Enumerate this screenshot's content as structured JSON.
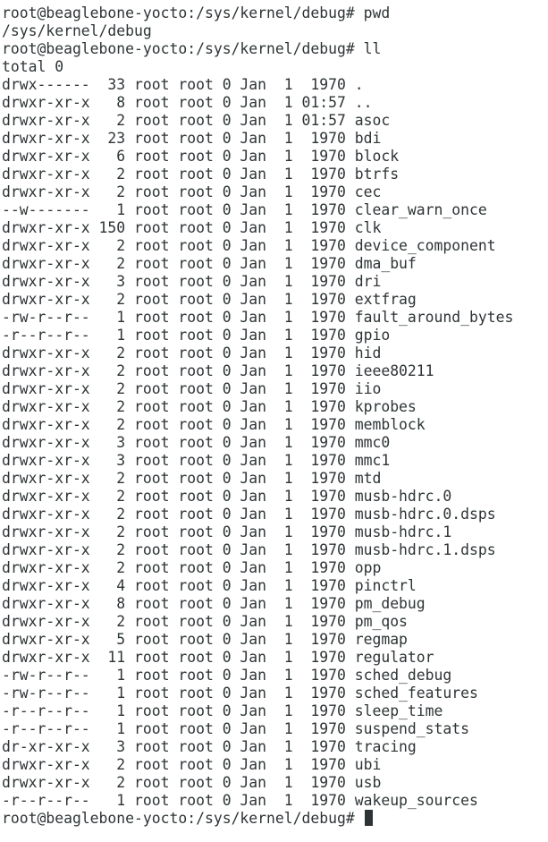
{
  "terminal": {
    "prompt": "root@beaglebone-yocto:/sys/kernel/debug#",
    "lines": [
      "root@beaglebone-yocto:/sys/kernel/debug# pwd",
      "/sys/kernel/debug",
      "root@beaglebone-yocto:/sys/kernel/debug# ll",
      "total 0",
      "drwx------  33 root root 0 Jan  1  1970 .",
      "drwxr-xr-x   8 root root 0 Jan  1 01:57 ..",
      "drwxr-xr-x   2 root root 0 Jan  1 01:57 asoc",
      "drwxr-xr-x  23 root root 0 Jan  1  1970 bdi",
      "drwxr-xr-x   6 root root 0 Jan  1  1970 block",
      "drwxr-xr-x   2 root root 0 Jan  1  1970 btrfs",
      "drwxr-xr-x   2 root root 0 Jan  1  1970 cec",
      "--w-------   1 root root 0 Jan  1  1970 clear_warn_once",
      "drwxr-xr-x 150 root root 0 Jan  1  1970 clk",
      "drwxr-xr-x   2 root root 0 Jan  1  1970 device_component",
      "drwxr-xr-x   2 root root 0 Jan  1  1970 dma_buf",
      "drwxr-xr-x   3 root root 0 Jan  1  1970 dri",
      "drwxr-xr-x   2 root root 0 Jan  1  1970 extfrag",
      "-rw-r--r--   1 root root 0 Jan  1  1970 fault_around_bytes",
      "-r--r--r--   1 root root 0 Jan  1  1970 gpio",
      "drwxr-xr-x   2 root root 0 Jan  1  1970 hid",
      "drwxr-xr-x   2 root root 0 Jan  1  1970 ieee80211",
      "drwxr-xr-x   2 root root 0 Jan  1  1970 iio",
      "drwxr-xr-x   2 root root 0 Jan  1  1970 kprobes",
      "drwxr-xr-x   2 root root 0 Jan  1  1970 memblock",
      "drwxr-xr-x   3 root root 0 Jan  1  1970 mmc0",
      "drwxr-xr-x   3 root root 0 Jan  1  1970 mmc1",
      "drwxr-xr-x   2 root root 0 Jan  1  1970 mtd",
      "drwxr-xr-x   2 root root 0 Jan  1  1970 musb-hdrc.0",
      "drwxr-xr-x   2 root root 0 Jan  1  1970 musb-hdrc.0.dsps",
      "drwxr-xr-x   2 root root 0 Jan  1  1970 musb-hdrc.1",
      "drwxr-xr-x   2 root root 0 Jan  1  1970 musb-hdrc.1.dsps",
      "drwxr-xr-x   2 root root 0 Jan  1  1970 opp",
      "drwxr-xr-x   4 root root 0 Jan  1  1970 pinctrl",
      "drwxr-xr-x   8 root root 0 Jan  1  1970 pm_debug",
      "drwxr-xr-x   2 root root 0 Jan  1  1970 pm_qos",
      "drwxr-xr-x   5 root root 0 Jan  1  1970 regmap",
      "drwxr-xr-x  11 root root 0 Jan  1  1970 regulator",
      "-rw-r--r--   1 root root 0 Jan  1  1970 sched_debug",
      "-rw-r--r--   1 root root 0 Jan  1  1970 sched_features",
      "-r--r--r--   1 root root 0 Jan  1  1970 sleep_time",
      "-r--r--r--   1 root root 0 Jan  1  1970 suspend_stats",
      "dr-xr-xr-x   3 root root 0 Jan  1  1970 tracing",
      "drwxr-xr-x   2 root root 0 Jan  1  1970 ubi",
      "drwxr-xr-x   2 root root 0 Jan  1  1970 usb",
      "-r--r--r--   1 root root 0 Jan  1  1970 wakeup_sources"
    ]
  },
  "colors": {
    "background": "#ffffff",
    "foreground": "#2e3436"
  }
}
